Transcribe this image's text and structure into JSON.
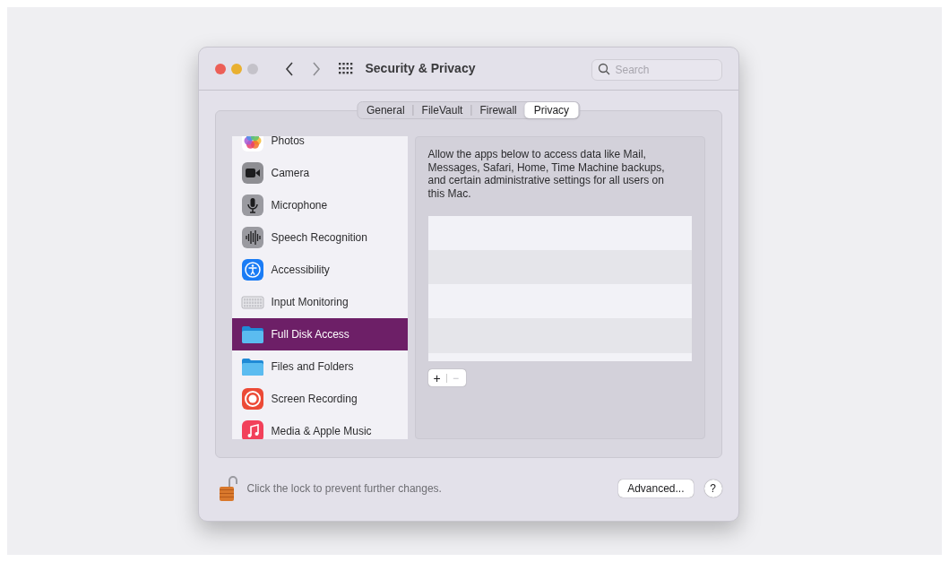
{
  "window": {
    "title": "Security & Privacy"
  },
  "search": {
    "placeholder": "Search"
  },
  "tabs": [
    {
      "label": "General",
      "selected": false
    },
    {
      "label": "FileVault",
      "selected": false
    },
    {
      "label": "Firewall",
      "selected": false
    },
    {
      "label": "Privacy",
      "selected": true
    }
  ],
  "sidebar": {
    "items": [
      {
        "label": "Photos",
        "kind": "photos",
        "selected": false
      },
      {
        "label": "Camera",
        "kind": "camera",
        "selected": false
      },
      {
        "label": "Microphone",
        "kind": "microphone",
        "selected": false
      },
      {
        "label": "Speech Recognition",
        "kind": "speech",
        "selected": false
      },
      {
        "label": "Accessibility",
        "kind": "accessibility",
        "selected": false
      },
      {
        "label": "Input Monitoring",
        "kind": "keyboard",
        "selected": false
      },
      {
        "label": "Full Disk Access",
        "kind": "folder",
        "selected": true
      },
      {
        "label": "Files and Folders",
        "kind": "folder",
        "selected": false
      },
      {
        "label": "Screen Recording",
        "kind": "record",
        "selected": false
      },
      {
        "label": "Media & Apple Music",
        "kind": "music",
        "selected": false
      }
    ]
  },
  "detail": {
    "description": "Allow the apps below to access data like Mail, Messages, Safari, Home, Time Machine backups, and certain administrative settings for all users on this Mac.",
    "add_button": "+",
    "remove_button": "−",
    "remove_disabled": true
  },
  "footer": {
    "lock_text": "Click the lock to prevent further changes.",
    "unlocked": true,
    "advanced_button": "Advanced...",
    "help_button": "?"
  }
}
